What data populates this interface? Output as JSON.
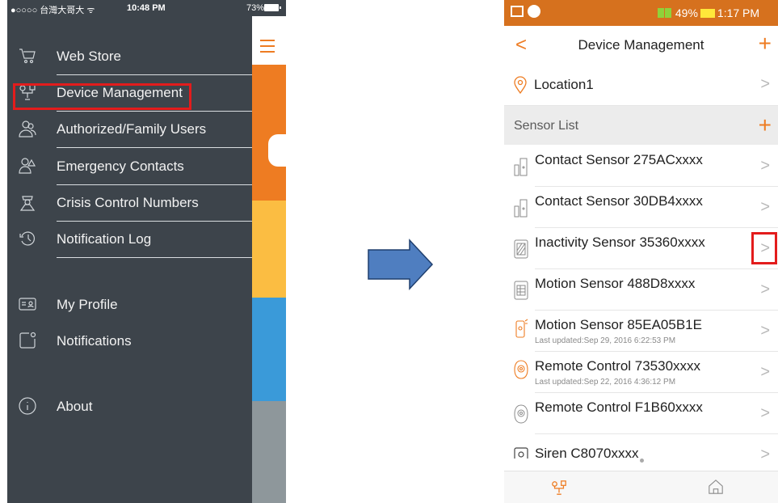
{
  "left_phone": {
    "status": {
      "carrier": "●○○○○ 台灣大哥大 ᯤ",
      "time": "10:48 PM",
      "battery": "73%"
    },
    "menu": [
      {
        "label": "Web Store",
        "icon": "cart-icon"
      },
      {
        "label": "Device Management",
        "icon": "device-icon"
      },
      {
        "label": "Authorized/Family Users",
        "icon": "users-icon"
      },
      {
        "label": "Emergency Contacts",
        "icon": "emergency-contact-icon"
      },
      {
        "label": "Crisis Control Numbers",
        "icon": "crisis-officer-icon"
      },
      {
        "label": "Notification Log",
        "icon": "history-icon"
      },
      {
        "label": "My Profile",
        "icon": "profile-card-icon"
      },
      {
        "label": "Notifications",
        "icon": "notification-icon"
      },
      {
        "label": "About",
        "icon": "info-icon"
      }
    ],
    "strip_colors": [
      "#ee7c22",
      "#fbbd42",
      "#3a9ad9",
      "#8e979b"
    ],
    "accent": "#ee7c22",
    "highlight_color": "#e31c1c"
  },
  "right_phone": {
    "status": {
      "battery": "49%",
      "time": "1:17 PM"
    },
    "header": {
      "title": "Device Management",
      "back": "<",
      "add": "+"
    },
    "location": {
      "label": "Location1"
    },
    "section": {
      "label": "Sensor List",
      "add": "+"
    },
    "sensors": [
      {
        "name": "Contact Sensor 275ACxxxx",
        "subtitle": "",
        "icon": "contact-sensor-icon"
      },
      {
        "name": "Contact Sensor 30DB4xxxx",
        "subtitle": "",
        "icon": "contact-sensor-icon"
      },
      {
        "name": "Inactivity Sensor 35360xxxx",
        "subtitle": "",
        "icon": "inactivity-sensor-icon"
      },
      {
        "name": "Motion Sensor 488D8xxxx",
        "subtitle": "",
        "icon": "motion-sensor-icon"
      },
      {
        "name": "Motion Sensor 85EA05B1E",
        "subtitle": "Last updated:Sep 29, 2016 6:22:53 PM",
        "icon": "motion-sensor-orange-icon"
      },
      {
        "name": "Remote Control 73530xxxx",
        "subtitle": "Last updated:Sep 22, 2016 4:36:12 PM",
        "icon": "remote-control-orange-icon"
      },
      {
        "name": "Remote Control F1B60xxxx",
        "subtitle": "",
        "icon": "remote-control-icon"
      },
      {
        "name": "Siren C8070xxxx",
        "subtitle": "",
        "icon": "siren-icon"
      }
    ],
    "chevron": ">",
    "tabs": [
      {
        "icon": "device-tab-icon"
      },
      {
        "icon": "home-icon"
      }
    ],
    "accent": "#ee7c22",
    "status_bar_color": "#d6711e"
  },
  "arrow": {
    "color": "#4f7ec0"
  }
}
